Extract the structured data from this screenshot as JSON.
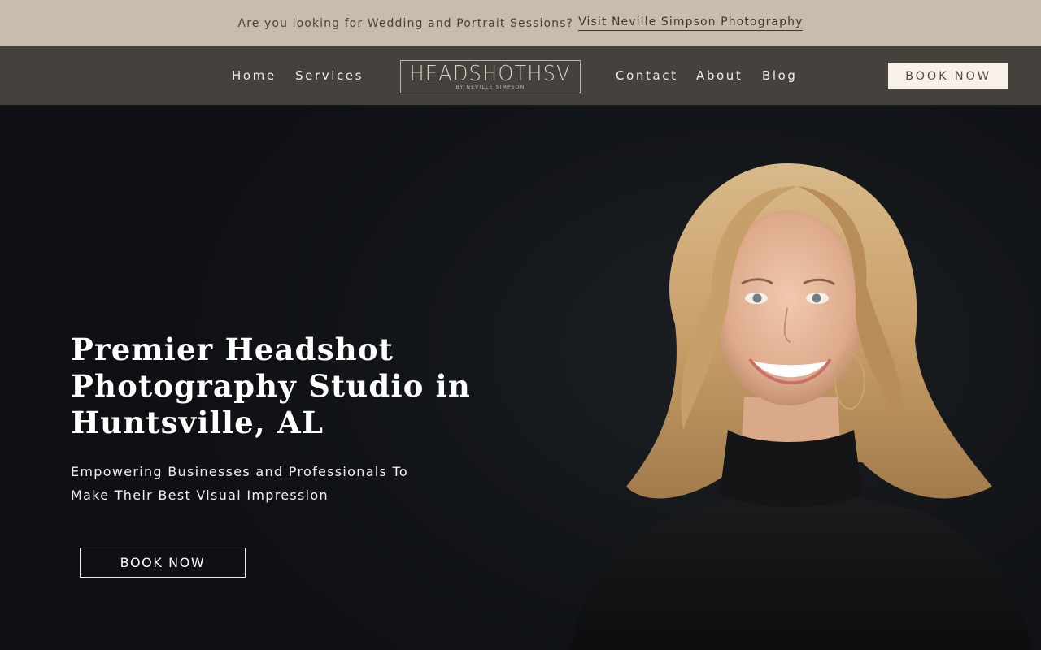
{
  "announcement": {
    "text": "Are you looking for Wedding and Portrait Sessions?",
    "link_label": "Visit Neville Simpson Photography"
  },
  "nav": {
    "left": [
      "Home",
      "Services"
    ],
    "right": [
      "Contact",
      "About",
      "Blog"
    ],
    "book_label": "BOOK NOW"
  },
  "logo": {
    "main": "HEADSHOTHSV",
    "sub": "BY NEVILLE SIMPSON"
  },
  "hero": {
    "title": "Premier Headshot Photography Studio in Huntsville, AL",
    "subtitle": "Empowering Businesses and Professionals To Make Their Best Visual Impression",
    "cta_label": "BOOK NOW"
  },
  "colors": {
    "announce_bar_bg": "#c9bcac",
    "header_bg": "#45423d",
    "hero_bg": "#131619",
    "button_light_bg": "#f7f1ea"
  }
}
